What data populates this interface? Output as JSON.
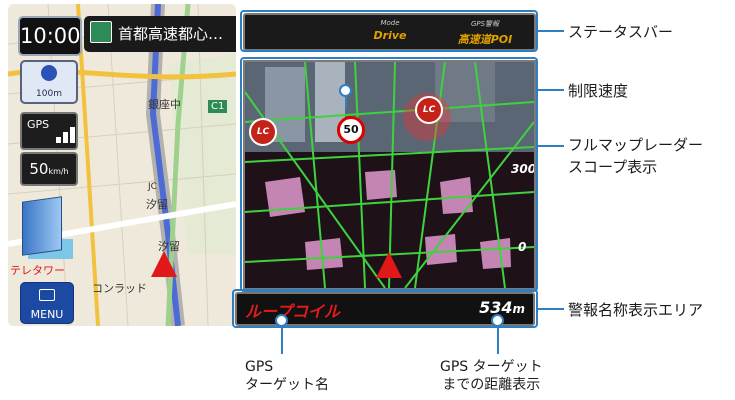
{
  "map": {
    "clock": "10:00",
    "route_name": "首都高速都心…",
    "scale": "100m",
    "gps_label": "GPS",
    "gps_bars": 3,
    "speed_value": "50",
    "speed_unit": "km/h",
    "menu_label": "MENU",
    "labels": {
      "ginza": "銀座中",
      "junction": "JC",
      "shiodome": "汐留",
      "shiodome2": "汐留",
      "teletower": "テレタワー",
      "conrad": "コンラッド",
      "c1": "C1"
    }
  },
  "status_bar": {
    "mode_key": "Mode",
    "mode_value": "Drive",
    "gps_key": "GPS警報",
    "gps_value": "高速道POI"
  },
  "radar": {
    "lc_left": "LC",
    "lc_right": "LC",
    "limit": "50",
    "right_values": [
      "300",
      "0"
    ]
  },
  "warning": {
    "target_name": "ループコイル",
    "distance_value": "534",
    "distance_unit": "m"
  },
  "annotations": {
    "status_bar": "ステータスバー",
    "speed_limit": "制限速度",
    "radar_line1": "フルマップレーダー",
    "radar_line2": "スコープ表示",
    "warning_area": "警報名称表示エリア",
    "gps_name_line1": "GPS",
    "gps_name_line2": "ターゲット名",
    "gps_dist_line1": "GPS ターゲット",
    "gps_dist_line2": "までの距離表示"
  },
  "colors": {
    "accent": "#2f7ec2",
    "warning_text": "#e41b1b",
    "status_value": "#e0a100",
    "radar_grid": "#3fd23f"
  }
}
